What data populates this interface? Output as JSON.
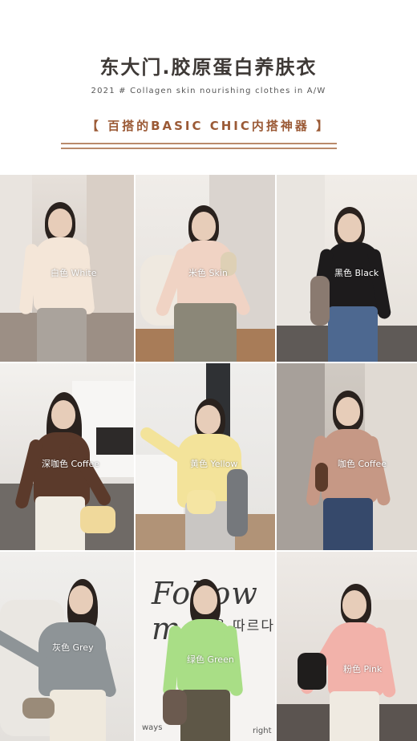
{
  "header": {
    "title": "东大门.胶原蛋白养肤衣",
    "subtitle": "2021 # Collagen skin nourishing clothes in A/W",
    "tagline": "【 百搭的BASIC CHIC内搭神器 】"
  },
  "tiles": [
    {
      "caption": "白色 White",
      "shirt_color": "#f4e6d8",
      "bg_color": "#dcd5cf"
    },
    {
      "caption": "米色 Skin",
      "shirt_color": "#f0d3c4",
      "bg_color": "#ece8e3"
    },
    {
      "caption": "黑色 Black",
      "shirt_color": "#1d1b1c",
      "bg_color": "#e8e3dd"
    },
    {
      "caption": "深咖色 Coffee",
      "shirt_color": "#5b3a2b",
      "bg_color": "#d9d6d3"
    },
    {
      "caption": "黄色 Yellow",
      "shirt_color": "#f3e39a",
      "bg_color": "#ece9e6"
    },
    {
      "caption": "咖色 Coffee",
      "shirt_color": "#c69885",
      "bg_color": "#cfc9c3"
    },
    {
      "caption": "灰色 Grey",
      "shirt_color": "#8e9497",
      "bg_color": "#e4e2df"
    },
    {
      "caption": "绿色 Green",
      "shirt_color": "#a9de86",
      "bg_color": "#f4f2f0"
    },
    {
      "caption": "粉色 Pink",
      "shirt_color": "#f2b2aa",
      "bg_color": "#e6e2de"
    }
  ],
  "cover_text": {
    "script": "Follow m",
    "korean": "을 따르다",
    "small_1": "ways",
    "small_2": "right"
  },
  "colors": {
    "title": "#3e3936",
    "tagline": "#9b5a36",
    "rule": "#b98a6b"
  }
}
